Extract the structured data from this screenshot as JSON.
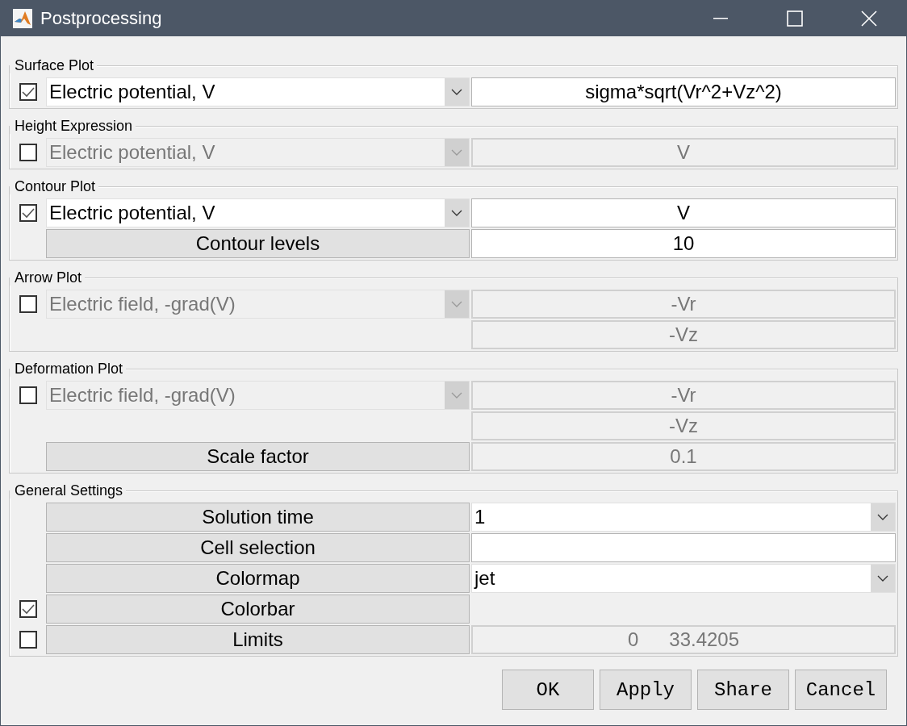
{
  "window": {
    "title": "Postprocessing"
  },
  "sections": [
    {
      "title": "Surface Plot",
      "rows": [
        {
          "checkbox": {
            "checked": true
          },
          "left": {
            "kind": "dropdown",
            "text": "Electric potential, V",
            "disabled": false
          },
          "right": {
            "kind": "field",
            "value": "sigma*sqrt(Vr^2+Vz^2)",
            "disabled": false
          }
        }
      ]
    },
    {
      "title": "Height Expression",
      "rows": [
        {
          "checkbox": {
            "checked": false
          },
          "left": {
            "kind": "dropdown",
            "text": "Electric potential, V",
            "disabled": true
          },
          "right": {
            "kind": "field",
            "value": "V",
            "disabled": true
          }
        }
      ]
    },
    {
      "title": "Contour Plot",
      "rows": [
        {
          "checkbox": {
            "checked": true
          },
          "left": {
            "kind": "dropdown",
            "text": "Electric potential, V",
            "disabled": false
          },
          "right": {
            "kind": "field",
            "value": "V",
            "disabled": false
          }
        },
        {
          "left": {
            "kind": "button",
            "text": "Contour levels"
          },
          "right": {
            "kind": "field",
            "value": "10",
            "disabled": false
          }
        }
      ]
    },
    {
      "title": "Arrow Plot",
      "rows": [
        {
          "checkbox": {
            "checked": false
          },
          "left": {
            "kind": "dropdown",
            "text": "Electric field, -grad(V)",
            "disabled": true
          },
          "right": {
            "kind": "field",
            "value": "-Vr",
            "disabled": true
          }
        },
        {
          "right": {
            "kind": "field",
            "value": "-Vz",
            "disabled": true
          }
        }
      ]
    },
    {
      "title": "Deformation Plot",
      "rows": [
        {
          "checkbox": {
            "checked": false
          },
          "left": {
            "kind": "dropdown",
            "text": "Electric field, -grad(V)",
            "disabled": true
          },
          "right": {
            "kind": "field",
            "value": "-Vr",
            "disabled": true
          }
        },
        {
          "right": {
            "kind": "field",
            "value": "-Vz",
            "disabled": true
          }
        },
        {
          "left": {
            "kind": "button",
            "text": "Scale factor"
          },
          "right": {
            "kind": "field",
            "value": "0.1",
            "disabled": true
          }
        }
      ]
    },
    {
      "title": "General Settings",
      "rows": [
        {
          "left": {
            "kind": "button",
            "text": "Solution time"
          },
          "right": {
            "kind": "dropdown",
            "value": "1",
            "disabled": false
          }
        },
        {
          "left": {
            "kind": "button",
            "text": "Cell selection"
          },
          "right": {
            "kind": "field",
            "disabled": false
          }
        },
        {
          "left": {
            "kind": "button",
            "text": "Colormap"
          },
          "right": {
            "kind": "dropdown",
            "value": "jet",
            "disabled": false
          }
        },
        {
          "checkbox": {
            "checked": true
          },
          "left": {
            "kind": "button",
            "text": "Colorbar"
          }
        },
        {
          "checkbox": {
            "checked": false
          },
          "left": {
            "kind": "button",
            "text": "Limits"
          },
          "right": {
            "kind": "pair",
            "values": [
              "0",
              "33.4205"
            ],
            "disabled": true
          }
        }
      ]
    }
  ],
  "buttons": [
    "OK",
    "Apply",
    "Share",
    "Cancel"
  ]
}
